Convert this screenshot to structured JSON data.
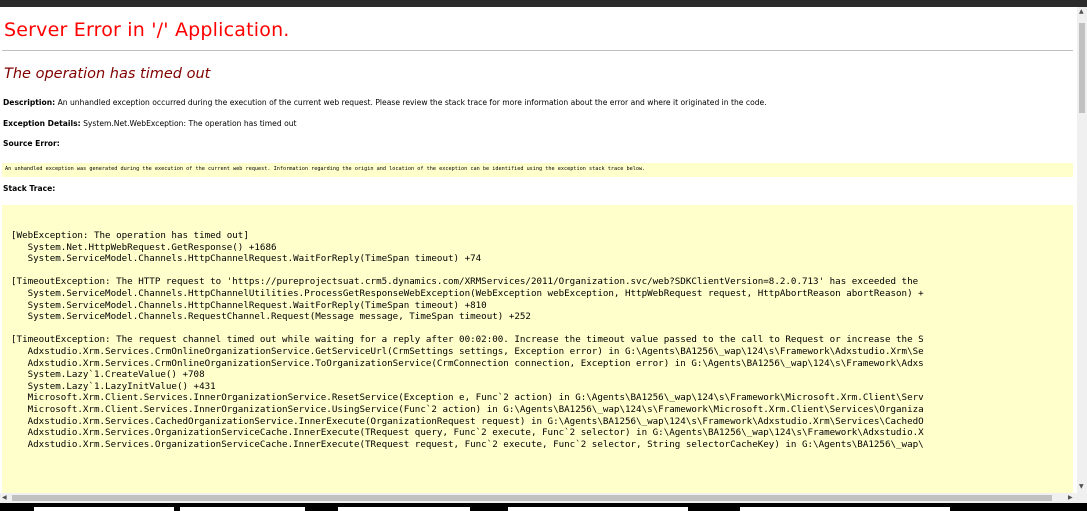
{
  "page": {
    "title": "Server Error in '/' Application.",
    "subtitle": "The operation has timed out",
    "description_label": "Description:",
    "description_text": "An unhandled exception occurred during the execution of the current web request. Please review the stack trace for more information about the error and where it originated in the code.",
    "exception_label": "Exception Details:",
    "exception_text": "System.Net.WebException: The operation has timed out",
    "source_error_label": "Source Error:",
    "source_error_text": "An unhandled exception was generated during the execution of the current web request. Information regarding the origin and location of the exception can be identified using the exception stack trace below.",
    "stack_trace_label": "Stack Trace:",
    "stack_trace": "[WebException: The operation has timed out]\n   System.Net.HttpWebRequest.GetResponse() +1686\n   System.ServiceModel.Channels.HttpChannelRequest.WaitForReply(TimeSpan timeout) +74\n\n[TimeoutException: The HTTP request to 'https://pureprojectsuat.crm5.dynamics.com/XRMServices/2011/Organization.svc/web?SDKClientVersion=8.2.0.713' has exceeded the\n   System.ServiceModel.Channels.HttpChannelUtilities.ProcessGetResponseWebException(WebException webException, HttpWebRequest request, HttpAbortReason abortReason) +\n   System.ServiceModel.Channels.HttpChannelRequest.WaitForReply(TimeSpan timeout) +810\n   System.ServiceModel.Channels.RequestChannel.Request(Message message, TimeSpan timeout) +252\n\n[TimeoutException: The request channel timed out while waiting for a reply after 00:02:00. Increase the timeout value passed to the call to Request or increase the S\n   Adxstudio.Xrm.Services.CrmOnlineOrganizationService.GetServiceUrl(CrmSettings settings, Exception error) in G:\\Agents\\BA1256\\_wap\\124\\s\\Framework\\Adxstudio.Xrm\\Se\n   Adxstudio.Xrm.Services.CrmOnlineOrganizationService.ToOrganizationService(CrmConnection connection, Exception error) in G:\\Agents\\BA1256\\_wap\\124\\s\\Framework\\Adxs\n   System.Lazy`1.CreateValue() +708\n   System.Lazy`1.LazyInitValue() +431\n   Microsoft.Xrm.Client.Services.InnerOrganizationService.ResetService(Exception e, Func`2 action) in G:\\Agents\\BA1256\\_wap\\124\\s\\Framework\\Microsoft.Xrm.Client\\Serv\n   Microsoft.Xrm.Client.Services.InnerOrganizationService.UsingService(Func`2 action) in G:\\Agents\\BA1256\\_wap\\124\\s\\Framework\\Microsoft.Xrm.Client\\Services\\Organiza\n   Adxstudio.Xrm.Services.CachedOrganizationService.InnerExecute(OrganizationRequest request) in G:\\Agents\\BA1256\\_wap\\124\\s\\Framework\\Adxstudio.Xrm\\Services\\CachedO\n   Adxstudio.Xrm.Services.OrganizationServiceCache.InnerExecute(TRequest query, Func`2 execute, Func`2 selector) in G:\\Agents\\BA1256\\_wap\\124\\s\\Framework\\Adxstudio.X\n   Adxstudio.Xrm.Services.OrganizationServiceCache.InnerExecute(TRequest request, Func`2 execute, Func`2 selector, String selectorCacheKey) in G:\\Agents\\BA1256\\_wap\\"
  },
  "scrollbars": {
    "up_arrow": "▲",
    "down_arrow": "▼",
    "left_arrow": "◀",
    "right_arrow": "▶"
  },
  "colors": {
    "title": "#ff0000",
    "subtitle": "#800000",
    "highlight_bg": "#ffffcc"
  }
}
